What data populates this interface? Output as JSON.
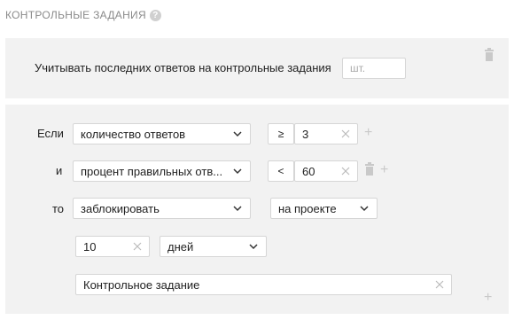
{
  "section": {
    "title": "КОНТРОЛЬНЫЕ ЗАДАНИЯ",
    "help_glyph": "?"
  },
  "limit": {
    "label": "Учитывать последних ответов на контрольные задания",
    "placeholder": "шт."
  },
  "rule": {
    "if_label": "Если",
    "and_label": "и",
    "then_label": "то",
    "condition1": {
      "field": "количество ответов",
      "operator": "≥",
      "value": "3"
    },
    "condition2": {
      "field": "процент правильных отв...",
      "operator": "<",
      "value": "60"
    },
    "action": {
      "value": "заблокировать",
      "scope": "на проекте"
    },
    "duration": {
      "value": "10",
      "unit": "дней"
    },
    "reason": {
      "value": "Контрольное задание"
    },
    "add_glyph": "+"
  },
  "colors": {
    "panel_bg": "#f2f2f2",
    "border": "#d6d6d6",
    "muted": "#c9c9c9"
  },
  "icons": [
    "help-icon",
    "trash-icon",
    "plus-icon",
    "chevron-down-icon",
    "clear-icon"
  ]
}
